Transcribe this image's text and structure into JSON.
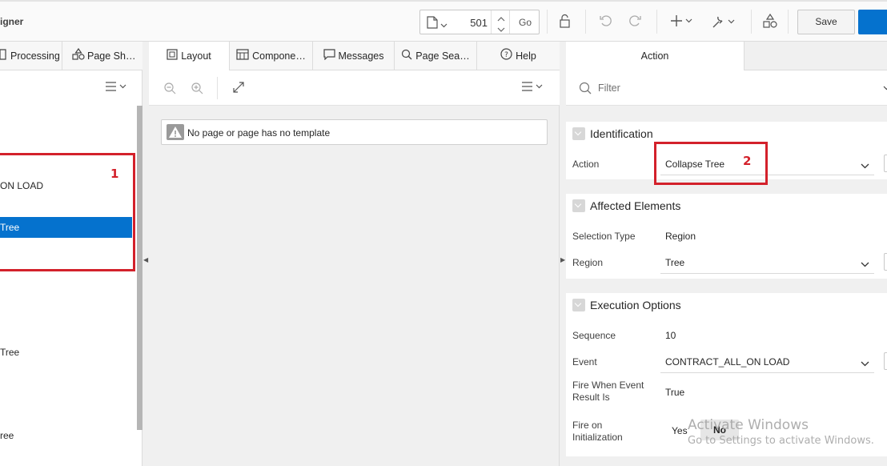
{
  "app": {
    "title_fragment": "igner"
  },
  "toolbar": {
    "page_number": "501",
    "go_label": "Go",
    "save_label": "Save"
  },
  "left_pane": {
    "tabs": [
      {
        "label": "Processing",
        "icon": "processing-icon"
      },
      {
        "label": "Page Sh…",
        "icon": "shared-components-icon"
      }
    ],
    "tree_nodes": [
      {
        "label": "ON LOAD"
      },
      {
        "label": "Tree",
        "selected": true
      },
      {
        "label": "Tree"
      },
      {
        "label": "ree"
      }
    ],
    "annotation": "1"
  },
  "center_pane": {
    "tabs": [
      {
        "label": "Layout",
        "icon": "layout-icon",
        "active": true
      },
      {
        "label": "Compone…",
        "icon": "component-view-icon"
      },
      {
        "label": "Messages",
        "icon": "messages-icon"
      },
      {
        "label": "Page Sea…",
        "icon": "search-icon"
      },
      {
        "label": "Help",
        "icon": "help-icon"
      }
    ],
    "message": "No page or page has no template"
  },
  "right_pane": {
    "tab": "Action",
    "filter_placeholder": "Filter",
    "annotation": "2",
    "groups": {
      "identification": {
        "title": "Identification",
        "action_label": "Action",
        "action_value": "Collapse Tree"
      },
      "affected": {
        "title": "Affected Elements",
        "selection_type_label": "Selection Type",
        "selection_type_value": "Region",
        "region_label": "Region",
        "region_value": "Tree"
      },
      "execution": {
        "title": "Execution Options",
        "sequence_label": "Sequence",
        "sequence_value": "10",
        "event_label": "Event",
        "event_value": "CONTRACT_ALL_ON LOAD",
        "fire_when_label_1": "Fire When Event",
        "fire_when_label_2": "Result Is",
        "fire_when_value": "True",
        "fire_init_label_1": "Fire on",
        "fire_init_label_2": "Initialization",
        "yes_label": "Yes",
        "no_label": "No"
      }
    }
  },
  "watermark": {
    "line1": "Activate Windows",
    "line2": "Go to Settings to activate Windows."
  },
  "colors": {
    "accent": "#0572ce",
    "annotation_red": "#d3212b"
  }
}
